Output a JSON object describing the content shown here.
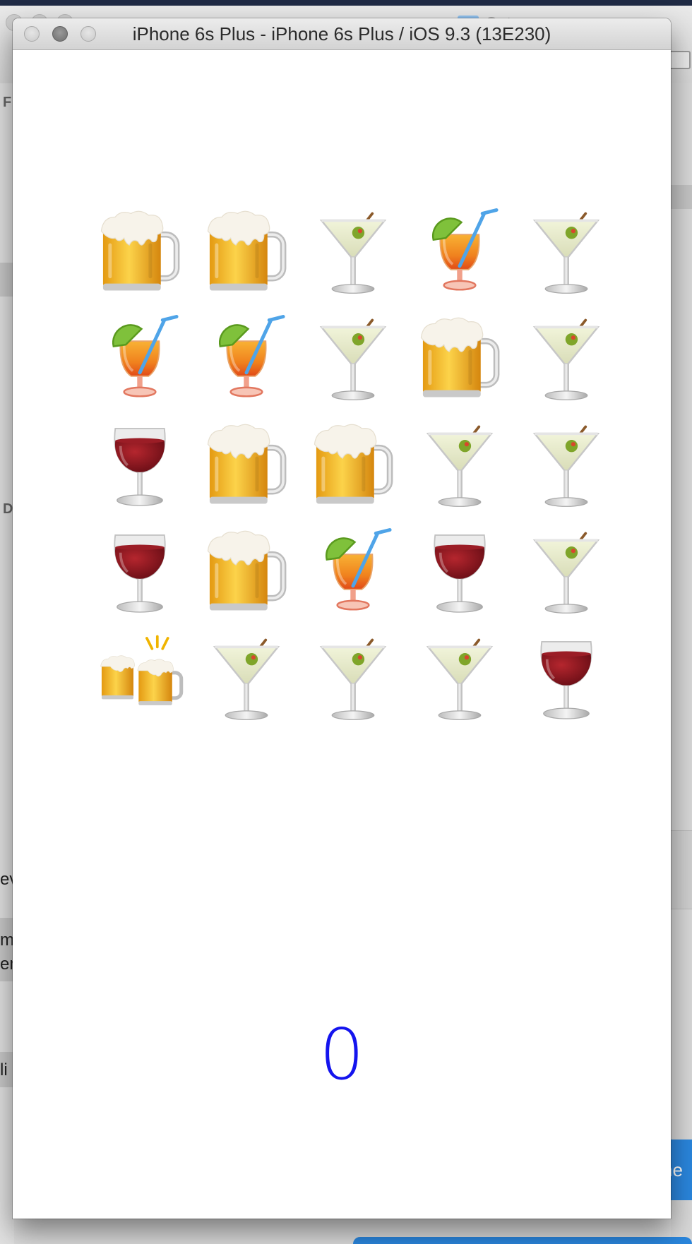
{
  "window": {
    "title": "iPhone 6s Plus - iPhone 6s Plus / iOS 9.3 (13E230)"
  },
  "background_app": {
    "folder_label": "Sets",
    "sidebar_fragments": [
      "F",
      "D",
      "ev",
      "m",
      "em",
      "li"
    ],
    "button_fragment": "ne"
  },
  "game": {
    "grid": [
      [
        "beer-mug",
        "beer-mug",
        "cocktail",
        "tropical-drink",
        "cocktail"
      ],
      [
        "tropical-drink",
        "tropical-drink",
        "cocktail",
        "beer-mug",
        "cocktail"
      ],
      [
        "wine-glass",
        "beer-mug",
        "beer-mug",
        "cocktail",
        "cocktail"
      ],
      [
        "wine-glass",
        "beer-mug",
        "tropical-drink",
        "wine-glass",
        "cocktail"
      ],
      [
        "clinking-beer-mugs",
        "cocktail",
        "cocktail",
        "cocktail",
        "wine-glass"
      ]
    ],
    "score": "0"
  },
  "colors": {
    "score": "#1414ee",
    "screen_background": "#ffffff"
  }
}
